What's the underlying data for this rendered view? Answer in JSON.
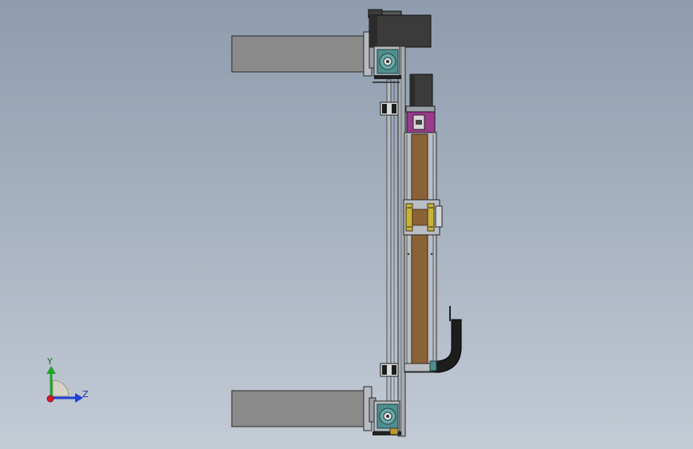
{
  "view": {
    "background_top": "#8e9cae",
    "background_bottom": "#c3cbd5"
  },
  "triad": {
    "y_label": "Y",
    "z_label": "Z",
    "y_color": "#1fa32c",
    "z_color": "#2340d8",
    "x_color": "#d8182a"
  },
  "colors": {
    "cylinder": "#8a8a8a",
    "motor_dark": "#3b3b3b",
    "rail": "#a9aeb4",
    "belt": "#8a6236",
    "magenta_block": "#9a3b8c",
    "teal_pulley": "#4f8f8f",
    "yellow_bracket": "#c9b23a",
    "chain_black": "#1d1d1d"
  }
}
